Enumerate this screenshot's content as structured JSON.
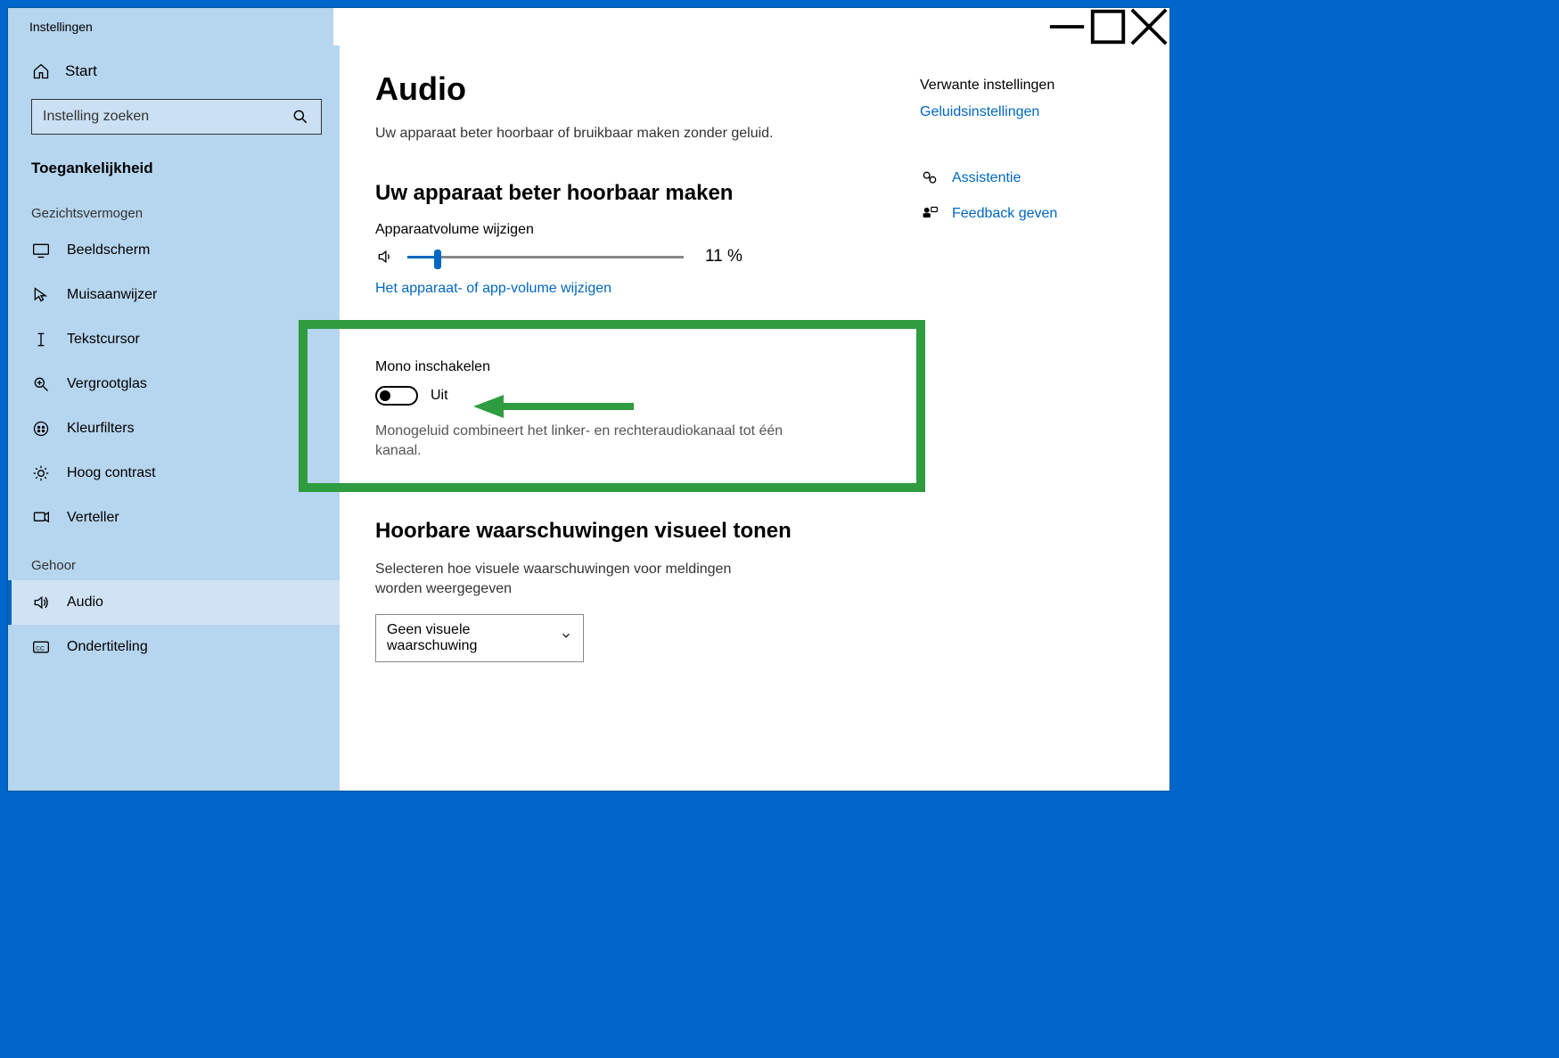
{
  "window": {
    "title": "Instellingen"
  },
  "sidebar": {
    "home": "Start",
    "search_placeholder": "Instelling zoeken",
    "section": "Toegankelijkheid",
    "group1": "Gezichtsvermogen",
    "items1": [
      {
        "label": "Beeldscherm"
      },
      {
        "label": "Muisaanwijzer"
      },
      {
        "label": "Tekstcursor"
      },
      {
        "label": "Vergrootglas"
      },
      {
        "label": "Kleurfilters"
      },
      {
        "label": "Hoog contrast"
      },
      {
        "label": "Verteller"
      }
    ],
    "group2": "Gehoor",
    "items2": [
      {
        "label": "Audio",
        "active": true
      },
      {
        "label": "Ondertiteling"
      }
    ]
  },
  "main": {
    "title": "Audio",
    "description": "Uw apparaat beter hoorbaar of bruikbaar maken zonder geluid.",
    "section1_title": "Uw apparaat beter hoorbaar maken",
    "volume_label": "Apparaatvolume wijzigen",
    "volume_percent": "11 %",
    "volume_value": 11,
    "volume_link": "Het apparaat- of app-volume wijzigen",
    "mono_label": "Mono inschakelen",
    "mono_state": "Uit",
    "mono_desc": "Monogeluid combineert het linker- en rechteraudiokanaal tot één kanaal.",
    "section2_title": "Hoorbare waarschuwingen visueel tonen",
    "visual_desc": "Selecteren hoe visuele waarschuwingen voor meldingen worden weergegeven",
    "dropdown_value": "Geen visuele waarschuwing"
  },
  "panel": {
    "related_title": "Verwante instellingen",
    "related_link": "Geluidsinstellingen",
    "help1": "Assistentie",
    "help2": "Feedback geven"
  }
}
